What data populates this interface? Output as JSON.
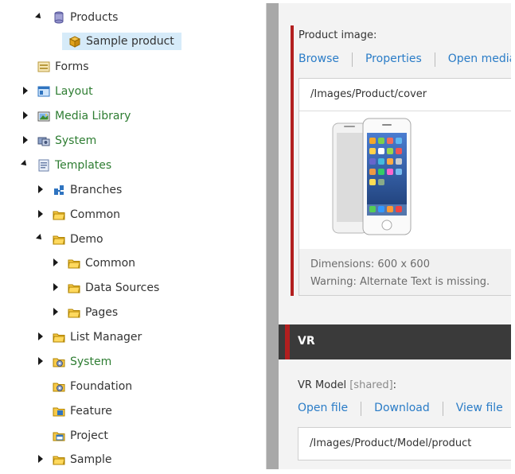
{
  "tree": {
    "items": [
      {
        "label": "Products",
        "icon": "database-icon",
        "arrow": "down",
        "level": 2
      },
      {
        "label": "Sample product",
        "icon": "product-box-icon",
        "arrow": "none",
        "level": 3,
        "selected": true
      },
      {
        "label": "Forms",
        "icon": "form-icon",
        "arrow": "none",
        "level": 1
      },
      {
        "label": "Layout",
        "icon": "layout-icon",
        "arrow": "right",
        "level": 1
      },
      {
        "label": "Media Library",
        "icon": "media-library-icon",
        "arrow": "right",
        "level": 1
      },
      {
        "label": "System",
        "icon": "system-icon",
        "arrow": "right",
        "level": 1
      },
      {
        "label": "Templates",
        "icon": "templates-icon",
        "arrow": "down",
        "level": 1
      },
      {
        "label": "Branches",
        "icon": "branches-icon",
        "arrow": "right",
        "level": 2
      },
      {
        "label": "Common",
        "icon": "folder-icon",
        "arrow": "right",
        "level": 2
      },
      {
        "label": "Demo",
        "icon": "folder-icon",
        "arrow": "down",
        "level": 2
      },
      {
        "label": "Common",
        "icon": "folder-icon",
        "arrow": "right",
        "level": 3
      },
      {
        "label": "Data Sources",
        "icon": "folder-icon",
        "arrow": "right",
        "level": 3
      },
      {
        "label": "Pages",
        "icon": "folder-icon",
        "arrow": "right",
        "level": 3
      },
      {
        "label": "List Manager",
        "icon": "folder-icon",
        "arrow": "right",
        "level": 2
      },
      {
        "label": "System",
        "icon": "gear-folder-icon",
        "arrow": "right",
        "level": 2
      },
      {
        "label": "Foundation",
        "icon": "gear-folder-icon",
        "arrow": "none",
        "level": 2
      },
      {
        "label": "Feature",
        "icon": "feature-folder-icon",
        "arrow": "none",
        "level": 2
      },
      {
        "label": "Project",
        "icon": "project-folder-icon",
        "arrow": "none",
        "level": 2
      },
      {
        "label": "Sample",
        "icon": "folder-icon",
        "arrow": "right",
        "level": 2
      }
    ]
  },
  "product_image": {
    "label": "Product image:",
    "links": [
      "Browse",
      "Properties",
      "Open media"
    ],
    "path": "/Images/Product/cover",
    "dimensions": "Dimensions: 600 x 600",
    "warning": "Warning: Alternate Text is missing."
  },
  "vr_section": {
    "title": "VR",
    "field_label": "VR Model",
    "field_shared": "[shared]",
    "field_colon": ":",
    "links": [
      "Open file",
      "Download",
      "View file"
    ],
    "path": "/Images/Product/Model/product"
  },
  "colors": {
    "accent_red": "#b21f1f",
    "link_blue": "#2a7cc7",
    "green_label": "#2e7d32",
    "selection": "#d6ebf9"
  }
}
